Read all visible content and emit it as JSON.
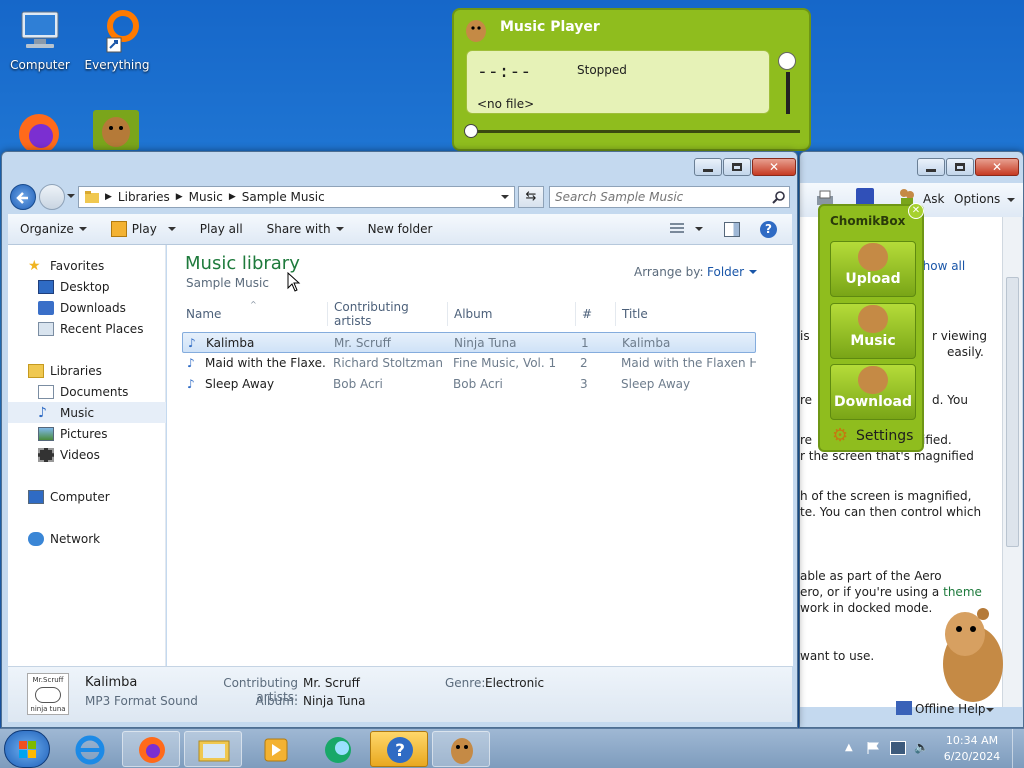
{
  "desktop": {
    "icons": [
      {
        "label": "Computer"
      },
      {
        "label": "Everything"
      }
    ]
  },
  "player": {
    "title": "Music Player",
    "time": "--:--",
    "status": "Stopped",
    "file": "<no file>"
  },
  "chomikbox": {
    "title": "ChomikBox",
    "upload": "Upload",
    "music": "Music",
    "download": "Download",
    "settings": "Settings"
  },
  "explorer": {
    "breadcrumb": [
      "Libraries",
      "Music",
      "Sample Music"
    ],
    "search_placeholder": "Search Sample Music",
    "toolbar": {
      "organize": "Organize",
      "play": "Play",
      "play_all": "Play all",
      "share_with": "Share with",
      "new_folder": "New folder"
    },
    "nav": {
      "favorites": "Favorites",
      "desktop": "Desktop",
      "downloads": "Downloads",
      "recent_places": "Recent Places",
      "libraries": "Libraries",
      "documents": "Documents",
      "music": "Music",
      "pictures": "Pictures",
      "videos": "Videos",
      "computer": "Computer",
      "network": "Network"
    },
    "library_title": "Music library",
    "library_subtitle": "Sample Music",
    "arrange_by_label": "Arrange by:",
    "arrange_by_value": "Folder",
    "columns": [
      "Name",
      "Contributing artists",
      "Album",
      "#",
      "Title"
    ],
    "rows": [
      {
        "name": "Kalimba",
        "artist": "Mr. Scruff",
        "album": "Ninja Tuna",
        "num": "1",
        "title": "Kalimba",
        "selected": true
      },
      {
        "name": "Maid with the Flaxe...",
        "artist": "Richard Stoltzman...",
        "album": "Fine Music, Vol. 1",
        "num": "2",
        "title": "Maid with the Flaxen H...",
        "selected": false
      },
      {
        "name": "Sleep Away",
        "artist": "Bob Acri",
        "album": "Bob Acri",
        "num": "3",
        "title": "Sleep Away",
        "selected": false
      }
    ],
    "details": {
      "art_line1": "Mr.Scruff",
      "art_line2": "ninja tuna",
      "name": "Kalimba",
      "type": "MP3 Format Sound",
      "artists_label": "Contributing artists:",
      "artists_value": "Mr. Scruff",
      "album_label": "Album:",
      "album_value": "Ninja Tuna",
      "genre_label": "Genre:",
      "genre_value": "Electronic"
    }
  },
  "help_window": {
    "ask": "Ask",
    "options": "Options",
    "show_all": "Show all",
    "lines": [
      "is",
      "r viewing",
      "easily.",
      "re",
      "d. You",
      "re",
      "ified.",
      "r the screen that's magnified",
      "h of the screen is magnified,",
      "te. You can then control which",
      "able as part of the Aero",
      "ero, or if you're using a",
      "work in docked mode.",
      "want to use."
    ],
    "theme_link": "theme",
    "offline_help": "Offline Help"
  },
  "taskbar": {
    "time": "10:34 AM",
    "date": "6/20/2024"
  },
  "colors": {
    "accent_green": "#8fbd1e",
    "library_title": "#1e7a3c",
    "link_blue": "#1a56a8"
  }
}
